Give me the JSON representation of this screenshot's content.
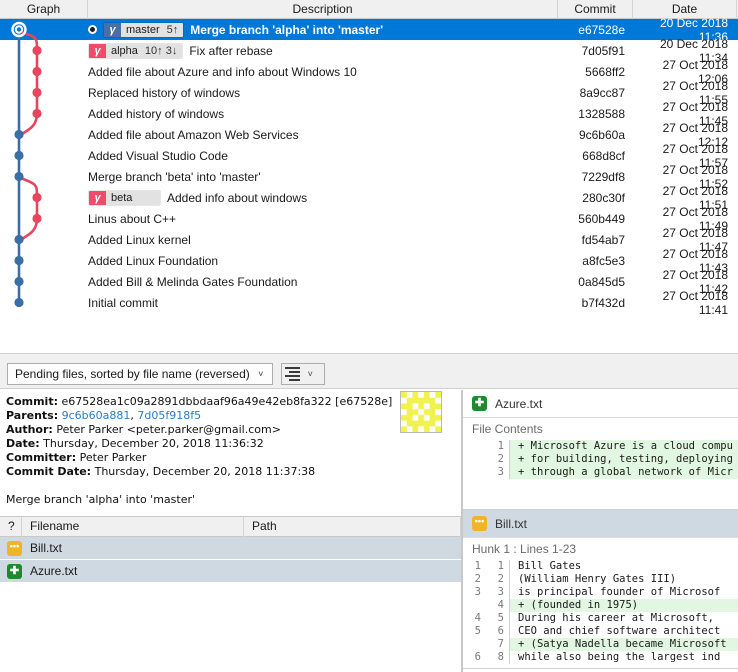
{
  "log": {
    "columns": [
      "Graph",
      "Description",
      "Commit",
      "Date"
    ],
    "rows": [
      {
        "description": "Merge branch 'alpha' into 'master'",
        "commit": "e67528e",
        "date": "20 Dec 2018 11:36",
        "selected": true,
        "merge_dot": true,
        "badge": {
          "name": "master",
          "count": "5↑",
          "icon": "branch-icon",
          "color": "#4a6fa5"
        }
      },
      {
        "description": "Fix after rebase",
        "commit": "7d05f91",
        "date": "20 Dec 2018 11:34",
        "selected": false,
        "merge_dot": false,
        "badge": {
          "name": "alpha",
          "count": "10↑ 3↓",
          "icon": "branch-icon",
          "color": "#ef4b6b"
        }
      },
      {
        "description": "Added file about Azure and info about Windows 10",
        "commit": "5668ff2",
        "date": "27 Oct 2018 12:06",
        "selected": false,
        "merge_dot": false,
        "badge": null
      },
      {
        "description": "Replaced history of windows",
        "commit": "8a9cc87",
        "date": "27 Oct 2018 11:55",
        "selected": false,
        "merge_dot": false,
        "badge": null
      },
      {
        "description": "Added history of windows",
        "commit": "1328588",
        "date": "27 Oct 2018 11:45",
        "selected": false,
        "merge_dot": false,
        "badge": null
      },
      {
        "description": "Added file about Amazon Web Services",
        "commit": "9c6b60a",
        "date": "27 Oct 2018 12:12",
        "selected": false,
        "merge_dot": false,
        "badge": null
      },
      {
        "description": "Added Visual Studio Code",
        "commit": "668d8cf",
        "date": "27 Oct 2018 11:57",
        "selected": false,
        "merge_dot": false,
        "badge": null
      },
      {
        "description": "Merge branch 'beta' into 'master'",
        "commit": "7229df8",
        "date": "27 Oct 2018 11:52",
        "selected": false,
        "merge_dot": false,
        "badge": null
      },
      {
        "description": "Added info about windows",
        "commit": "280c30f",
        "date": "27 Oct 2018 11:51",
        "selected": false,
        "merge_dot": false,
        "badge": {
          "name": "beta",
          "count": "",
          "icon": "branch-icon",
          "color": "#ef4b6b"
        }
      },
      {
        "description": "Linus about C++",
        "commit": "560b449",
        "date": "27 Oct 2018 11:49",
        "selected": false,
        "merge_dot": false,
        "badge": null
      },
      {
        "description": "Added Linux kernel",
        "commit": "fd54ab7",
        "date": "27 Oct 2018 11:47",
        "selected": false,
        "merge_dot": false,
        "badge": null
      },
      {
        "description": "Added Linux Foundation",
        "commit": "a8fc5e3",
        "date": "27 Oct 2018 11:43",
        "selected": false,
        "merge_dot": false,
        "badge": null
      },
      {
        "description": "Added Bill & Melinda Gates Foundation",
        "commit": "0a845d5",
        "date": "27 Oct 2018 11:42",
        "selected": false,
        "merge_dot": false,
        "badge": null
      },
      {
        "description": "Initial commit",
        "commit": "b7f432d",
        "date": "27 Oct 2018 11:41",
        "selected": false,
        "merge_dot": false,
        "badge": null
      }
    ]
  },
  "graph": {
    "colors": {
      "master": "#3a6ea5",
      "feature": "#e8455f",
      "selected_node_ring": "#ffffff"
    }
  },
  "toolbar": {
    "filter_label": "Pending files, sorted by file name (reversed)",
    "caret": "˅",
    "view_button_icon": "list-view-icon"
  },
  "detail": {
    "commit_label": "Commit:",
    "commit_value": "e67528ea1c09a2891dbbdaaf96a49e42eb8fa322 [e67528e]",
    "parents_label": "Parents:",
    "parent1": "9c6b60a881",
    "parent_sep": ", ",
    "parent2": "7d05f918f5",
    "author_label": "Author:",
    "author_value": "Peter Parker <peter.parker@gmail.com>",
    "date_label": "Date:",
    "date_value": "Thursday, December 20, 2018 11:36:32",
    "committer_label": "Committer:",
    "committer_value": "Peter Parker",
    "commit_date_label": "Commit Date:",
    "commit_date_value": "Thursday, December 20, 2018 11:37:38",
    "message": "Merge branch 'alpha' into 'master'",
    "avatar_icon": "identicon-avatar"
  },
  "files": {
    "columns": [
      "?",
      "Filename",
      "Path"
    ],
    "rows": [
      {
        "filename": "Bill.txt",
        "path": "",
        "status": "modified",
        "icon": "file-modified-icon"
      },
      {
        "filename": "Azure.txt",
        "path": "",
        "status": "added",
        "icon": "file-added-icon"
      }
    ]
  },
  "diff": {
    "blocks": [
      {
        "filename": "Azure.txt",
        "status": "added",
        "icon": "file-added-icon",
        "selected": false,
        "subtitle": "File Contents",
        "lines": [
          {
            "old": "",
            "new": "1",
            "marker": "+",
            "text": "Microsoft Azure is a cloud compu",
            "added": true
          },
          {
            "old": "",
            "new": "2",
            "marker": "+",
            "text": "for building, testing, deploying",
            "added": true
          },
          {
            "old": "",
            "new": "3",
            "marker": "+",
            "text": "through a global network of Micr",
            "added": true
          }
        ]
      },
      {
        "filename": "Bill.txt",
        "status": "modified",
        "icon": "file-modified-icon",
        "selected": true,
        "subtitle": "Hunk 1 : Lines 1-23",
        "lines": [
          {
            "old": "1",
            "new": "1",
            "marker": "",
            "text": "Bill Gates",
            "added": false
          },
          {
            "old": "2",
            "new": "2",
            "marker": "",
            "text": "(William Henry Gates III)",
            "added": false
          },
          {
            "old": "3",
            "new": "3",
            "marker": "",
            "text": "is principal founder of Microsof",
            "added": false
          },
          {
            "old": "",
            "new": "4",
            "marker": "+",
            "text": "(founded in 1975)",
            "added": true
          },
          {
            "old": "4",
            "new": "5",
            "marker": "",
            "text": "During his career at Microsoft,",
            "added": false
          },
          {
            "old": "5",
            "new": "6",
            "marker": "",
            "text": "CEO and chief software architect",
            "added": false
          },
          {
            "old": "",
            "new": "7",
            "marker": "+",
            "text": "(Satya Nadella became Microsoft",
            "added": true
          },
          {
            "old": "6",
            "new": "8",
            "marker": "",
            "text": "while also being the largest ind",
            "added": false
          }
        ]
      }
    ]
  }
}
